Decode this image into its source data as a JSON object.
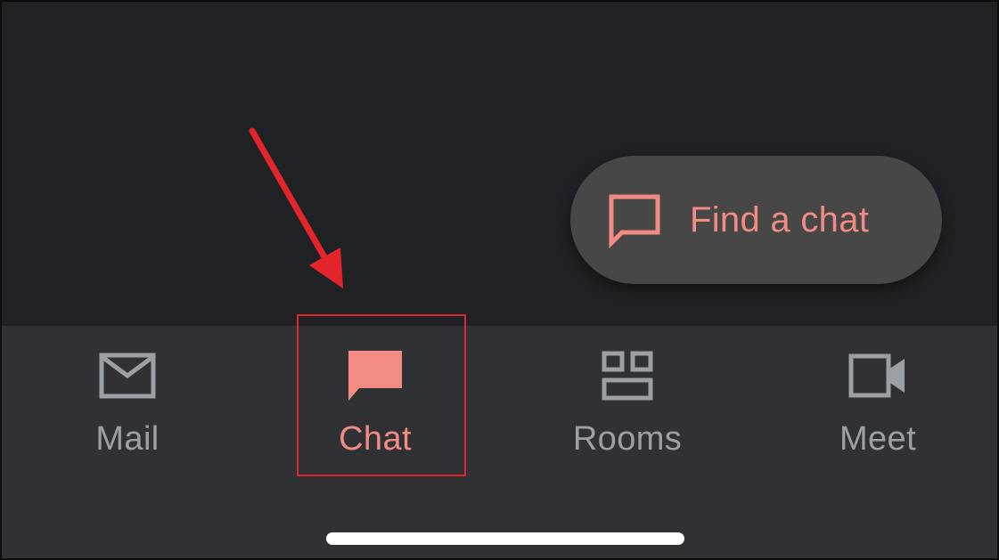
{
  "fab": {
    "label": "Find a chat",
    "icon": "chat-bubble-outline-icon"
  },
  "bottom_nav": {
    "items": [
      {
        "label": "Mail",
        "icon": "mail-icon",
        "active": false
      },
      {
        "label": "Chat",
        "icon": "chat-icon",
        "active": true
      },
      {
        "label": "Rooms",
        "icon": "rooms-icon",
        "active": false
      },
      {
        "label": "Meet",
        "icon": "video-camera-icon",
        "active": false
      }
    ]
  },
  "colors": {
    "background": "#202124",
    "nav_background": "#303134",
    "fab_background": "#474747",
    "accent": "#f28b82",
    "inactive": "#9aa0a6",
    "annotation": "#e3242b"
  }
}
